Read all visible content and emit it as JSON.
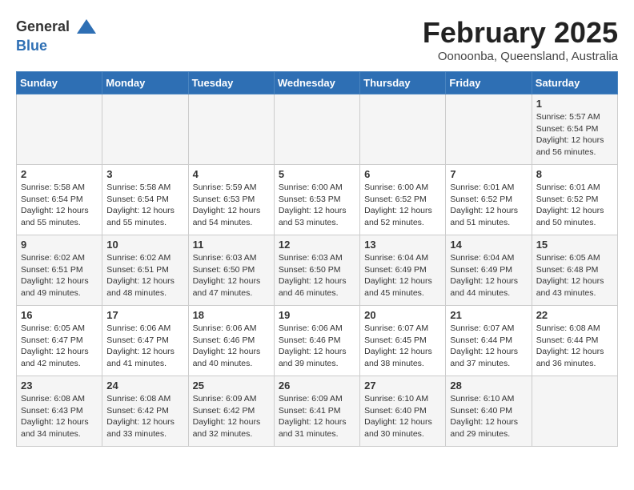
{
  "header": {
    "logo_line1": "General",
    "logo_line2": "Blue",
    "month": "February 2025",
    "location": "Oonoonba, Queensland, Australia"
  },
  "days_of_week": [
    "Sunday",
    "Monday",
    "Tuesday",
    "Wednesday",
    "Thursday",
    "Friday",
    "Saturday"
  ],
  "weeks": [
    [
      {
        "day": "",
        "info": ""
      },
      {
        "day": "",
        "info": ""
      },
      {
        "day": "",
        "info": ""
      },
      {
        "day": "",
        "info": ""
      },
      {
        "day": "",
        "info": ""
      },
      {
        "day": "",
        "info": ""
      },
      {
        "day": "1",
        "info": "Sunrise: 5:57 AM\nSunset: 6:54 PM\nDaylight: 12 hours\nand 56 minutes."
      }
    ],
    [
      {
        "day": "2",
        "info": "Sunrise: 5:58 AM\nSunset: 6:54 PM\nDaylight: 12 hours\nand 55 minutes."
      },
      {
        "day": "3",
        "info": "Sunrise: 5:58 AM\nSunset: 6:54 PM\nDaylight: 12 hours\nand 55 minutes."
      },
      {
        "day": "4",
        "info": "Sunrise: 5:59 AM\nSunset: 6:53 PM\nDaylight: 12 hours\nand 54 minutes."
      },
      {
        "day": "5",
        "info": "Sunrise: 6:00 AM\nSunset: 6:53 PM\nDaylight: 12 hours\nand 53 minutes."
      },
      {
        "day": "6",
        "info": "Sunrise: 6:00 AM\nSunset: 6:52 PM\nDaylight: 12 hours\nand 52 minutes."
      },
      {
        "day": "7",
        "info": "Sunrise: 6:01 AM\nSunset: 6:52 PM\nDaylight: 12 hours\nand 51 minutes."
      },
      {
        "day": "8",
        "info": "Sunrise: 6:01 AM\nSunset: 6:52 PM\nDaylight: 12 hours\nand 50 minutes."
      }
    ],
    [
      {
        "day": "9",
        "info": "Sunrise: 6:02 AM\nSunset: 6:51 PM\nDaylight: 12 hours\nand 49 minutes."
      },
      {
        "day": "10",
        "info": "Sunrise: 6:02 AM\nSunset: 6:51 PM\nDaylight: 12 hours\nand 48 minutes."
      },
      {
        "day": "11",
        "info": "Sunrise: 6:03 AM\nSunset: 6:50 PM\nDaylight: 12 hours\nand 47 minutes."
      },
      {
        "day": "12",
        "info": "Sunrise: 6:03 AM\nSunset: 6:50 PM\nDaylight: 12 hours\nand 46 minutes."
      },
      {
        "day": "13",
        "info": "Sunrise: 6:04 AM\nSunset: 6:49 PM\nDaylight: 12 hours\nand 45 minutes."
      },
      {
        "day": "14",
        "info": "Sunrise: 6:04 AM\nSunset: 6:49 PM\nDaylight: 12 hours\nand 44 minutes."
      },
      {
        "day": "15",
        "info": "Sunrise: 6:05 AM\nSunset: 6:48 PM\nDaylight: 12 hours\nand 43 minutes."
      }
    ],
    [
      {
        "day": "16",
        "info": "Sunrise: 6:05 AM\nSunset: 6:47 PM\nDaylight: 12 hours\nand 42 minutes."
      },
      {
        "day": "17",
        "info": "Sunrise: 6:06 AM\nSunset: 6:47 PM\nDaylight: 12 hours\nand 41 minutes."
      },
      {
        "day": "18",
        "info": "Sunrise: 6:06 AM\nSunset: 6:46 PM\nDaylight: 12 hours\nand 40 minutes."
      },
      {
        "day": "19",
        "info": "Sunrise: 6:06 AM\nSunset: 6:46 PM\nDaylight: 12 hours\nand 39 minutes."
      },
      {
        "day": "20",
        "info": "Sunrise: 6:07 AM\nSunset: 6:45 PM\nDaylight: 12 hours\nand 38 minutes."
      },
      {
        "day": "21",
        "info": "Sunrise: 6:07 AM\nSunset: 6:44 PM\nDaylight: 12 hours\nand 37 minutes."
      },
      {
        "day": "22",
        "info": "Sunrise: 6:08 AM\nSunset: 6:44 PM\nDaylight: 12 hours\nand 36 minutes."
      }
    ],
    [
      {
        "day": "23",
        "info": "Sunrise: 6:08 AM\nSunset: 6:43 PM\nDaylight: 12 hours\nand 34 minutes."
      },
      {
        "day": "24",
        "info": "Sunrise: 6:08 AM\nSunset: 6:42 PM\nDaylight: 12 hours\nand 33 minutes."
      },
      {
        "day": "25",
        "info": "Sunrise: 6:09 AM\nSunset: 6:42 PM\nDaylight: 12 hours\nand 32 minutes."
      },
      {
        "day": "26",
        "info": "Sunrise: 6:09 AM\nSunset: 6:41 PM\nDaylight: 12 hours\nand 31 minutes."
      },
      {
        "day": "27",
        "info": "Sunrise: 6:10 AM\nSunset: 6:40 PM\nDaylight: 12 hours\nand 30 minutes."
      },
      {
        "day": "28",
        "info": "Sunrise: 6:10 AM\nSunset: 6:40 PM\nDaylight: 12 hours\nand 29 minutes."
      },
      {
        "day": "",
        "info": ""
      }
    ]
  ]
}
